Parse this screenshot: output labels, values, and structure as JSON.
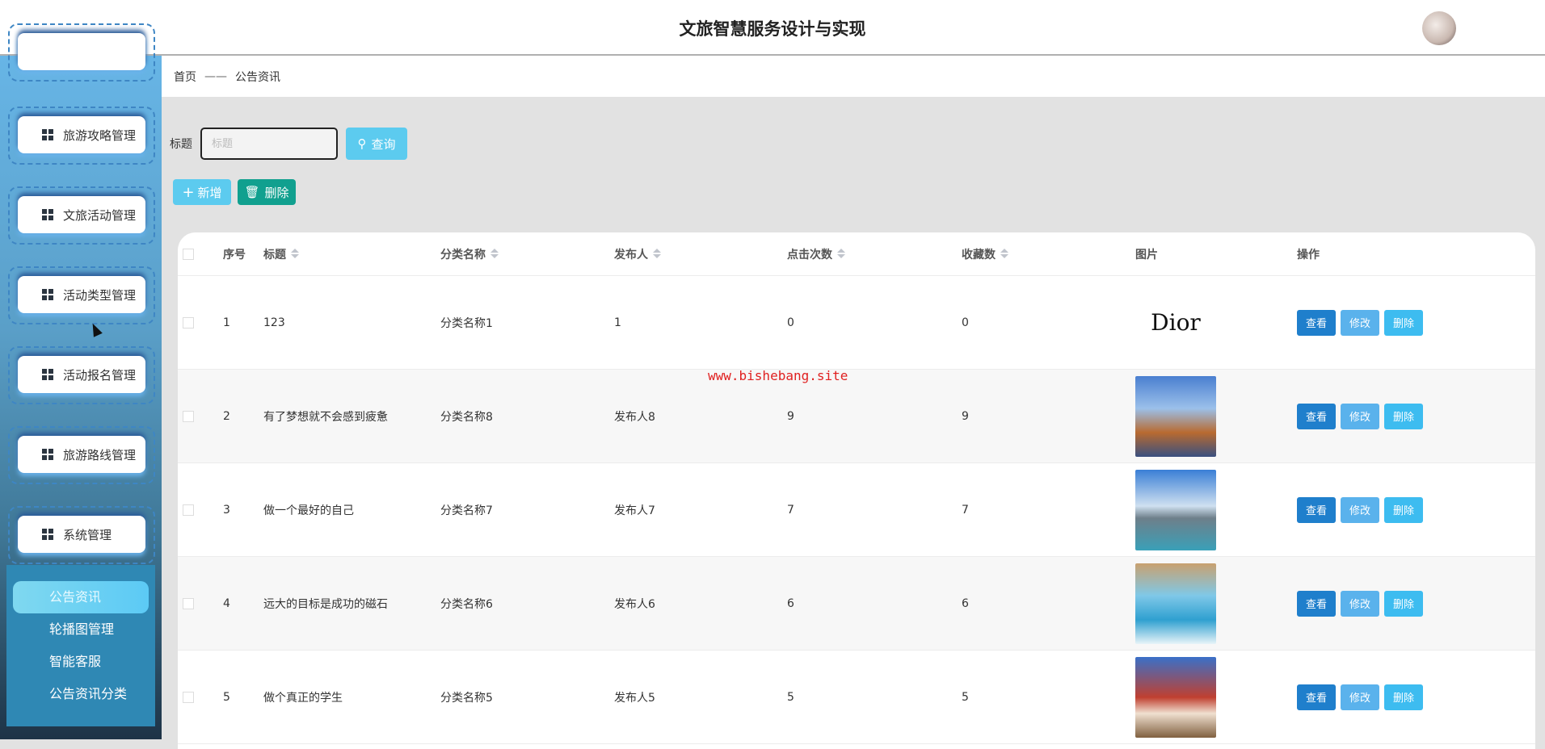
{
  "header": {
    "title": "文旅智慧服务设计与实现"
  },
  "sidebar": {
    "items": [
      {
        "label": "旅游攻略管理",
        "icon": "user-icon"
      },
      {
        "label": "文旅活动管理",
        "icon": "grid-icon"
      },
      {
        "label": "活动类型管理",
        "icon": "grid-icon"
      },
      {
        "label": "活动报名管理",
        "icon": "briefcase-icon"
      },
      {
        "label": "旅游路线管理",
        "icon": "grid-icon"
      },
      {
        "label": "系统管理",
        "icon": "grid-icon"
      }
    ],
    "submenu": [
      "公告资讯",
      "轮播图管理",
      "智能客服",
      "公告资讯分类"
    ]
  },
  "breadcrumb": {
    "home": "首页",
    "sep": "——",
    "current": "公告资讯"
  },
  "search": {
    "label": "标题",
    "placeholder": "标题",
    "button": "查询"
  },
  "actions": {
    "add": "新增",
    "delete": "删除"
  },
  "table": {
    "headers": [
      "序号",
      "标题",
      "分类名称",
      "发布人",
      "点击次数",
      "收藏数",
      "图片",
      "操作"
    ],
    "rows": [
      {
        "no": "1",
        "title": "123",
        "category": "分类名称1",
        "publisher": "1",
        "clicks": "0",
        "favorites": "0",
        "image": "Dior"
      },
      {
        "no": "2",
        "title": "有了梦想就不会感到疲惫",
        "category": "分类名称8",
        "publisher": "发布人8",
        "clicks": "9",
        "favorites": "9",
        "image": ""
      },
      {
        "no": "3",
        "title": "做一个最好的自己",
        "category": "分类名称7",
        "publisher": "发布人7",
        "clicks": "7",
        "favorites": "7",
        "image": ""
      },
      {
        "no": "4",
        "title": "远大的目标是成功的磁石",
        "category": "分类名称6",
        "publisher": "发布人6",
        "clicks": "6",
        "favorites": "6",
        "image": ""
      },
      {
        "no": "5",
        "title": "做个真正的学生",
        "category": "分类名称5",
        "publisher": "发布人5",
        "clicks": "5",
        "favorites": "5",
        "image": ""
      }
    ],
    "ops": {
      "view": "查看",
      "edit": "修改",
      "delete": "删除"
    }
  },
  "watermark": "www.bishebang.site"
}
